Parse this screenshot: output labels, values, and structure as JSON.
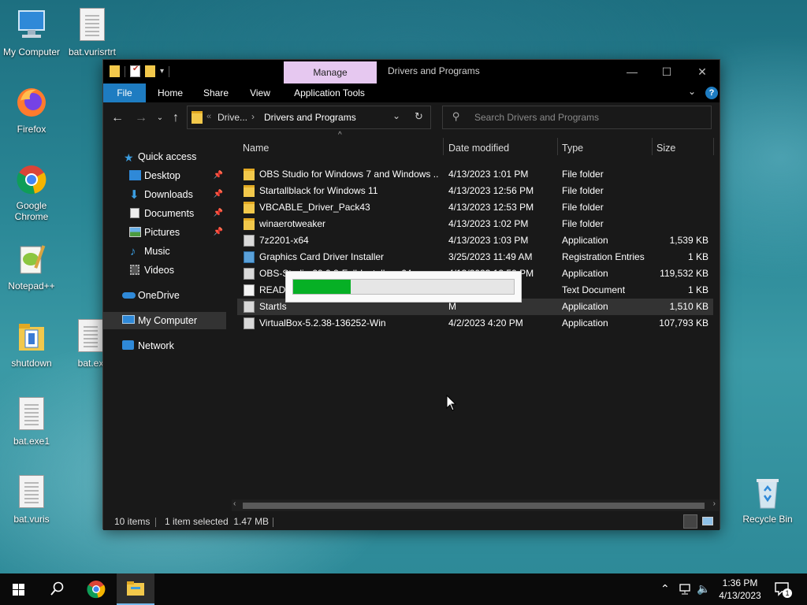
{
  "desktop": {
    "icons": [
      {
        "label": "My Computer"
      },
      {
        "label": "bat.vurisrtrt"
      },
      {
        "label": "Firefox"
      },
      {
        "label": "Google Chrome"
      },
      {
        "label": "Notepad++"
      },
      {
        "label": "shutdown"
      },
      {
        "label": "bat.ex"
      },
      {
        "label": "bat.exe1"
      },
      {
        "label": "bat.vuris"
      },
      {
        "label": "Recycle Bin"
      }
    ]
  },
  "window": {
    "context_tab": "Manage",
    "title": "Drivers and Programs",
    "controls": {
      "minimize": "—",
      "maximize": "☐",
      "close": "✕"
    }
  },
  "ribbon": {
    "tabs": [
      "File",
      "Home",
      "Share",
      "View",
      "Application Tools"
    ],
    "help": "?"
  },
  "address": {
    "crumbs": [
      "Drive...",
      "Drivers and Programs"
    ],
    "search_placeholder": "Search Drivers and Programs"
  },
  "nav": {
    "items": [
      {
        "label": "Quick access",
        "icon": "star-icon"
      },
      {
        "label": "Desktop",
        "icon": "desktop-icon",
        "pinned": true
      },
      {
        "label": "Downloads",
        "icon": "download-icon",
        "pinned": true
      },
      {
        "label": "Documents",
        "icon": "document-icon",
        "pinned": true
      },
      {
        "label": "Pictures",
        "icon": "pictures-icon",
        "pinned": true
      },
      {
        "label": "Music",
        "icon": "music-icon"
      },
      {
        "label": "Videos",
        "icon": "videos-icon"
      },
      {
        "label": "OneDrive",
        "icon": "cloud-icon"
      },
      {
        "label": "My Computer",
        "icon": "computer-icon"
      },
      {
        "label": "Network",
        "icon": "network-icon"
      }
    ]
  },
  "columns": [
    "Name",
    "Date modified",
    "Type",
    "Size"
  ],
  "files": [
    {
      "name": "OBS Studio for Windows 7 and Windows ...",
      "date": "4/13/2023 1:01 PM",
      "type": "File folder",
      "size": "",
      "icon": "folder"
    },
    {
      "name": "Startallblack for Windows 11",
      "date": "4/13/2023 12:56 PM",
      "type": "File folder",
      "size": "",
      "icon": "folder"
    },
    {
      "name": "VBCABLE_Driver_Pack43",
      "date": "4/13/2023 12:53 PM",
      "type": "File folder",
      "size": "",
      "icon": "folder"
    },
    {
      "name": "winaerotweaker",
      "date": "4/13/2023 1:02 PM",
      "type": "File folder",
      "size": "",
      "icon": "folder"
    },
    {
      "name": "7z2201-x64",
      "date": "4/13/2023 1:03 PM",
      "type": "Application",
      "size": "1,539 KB",
      "icon": "app"
    },
    {
      "name": "Graphics Card Driver Installer",
      "date": "3/25/2023 11:49 AM",
      "type": "Registration Entries",
      "size": "1 KB",
      "icon": "reg"
    },
    {
      "name": "OBS-Studio-29.0.2-Full-Installer-x64",
      "date": "4/13/2023 12:59 PM",
      "type": "Application",
      "size": "119,532 KB",
      "icon": "app"
    },
    {
      "name": "READ",
      "date": "M",
      "type": "Text Document",
      "size": "1 KB",
      "icon": "txt"
    },
    {
      "name": "StartIs",
      "date": "M",
      "type": "Application",
      "size": "1,510 KB",
      "icon": "app"
    },
    {
      "name": "VirtualBox-5.2.38-136252-Win",
      "date": "4/2/2023 4:20 PM",
      "type": "Application",
      "size": "107,793 KB",
      "icon": "app"
    }
  ],
  "selected_row": 8,
  "status": {
    "count": "10 items",
    "selection": "1 item selected  1.47 MB"
  },
  "progress": {
    "fraction": 0.26
  },
  "taskbar": {
    "time": "1:36 PM",
    "date": "4/13/2023",
    "notifications": "1"
  },
  "colors": {
    "accent": "#1e7cc1",
    "progress": "#06b025",
    "manage_tab": "#e6c8f0"
  }
}
